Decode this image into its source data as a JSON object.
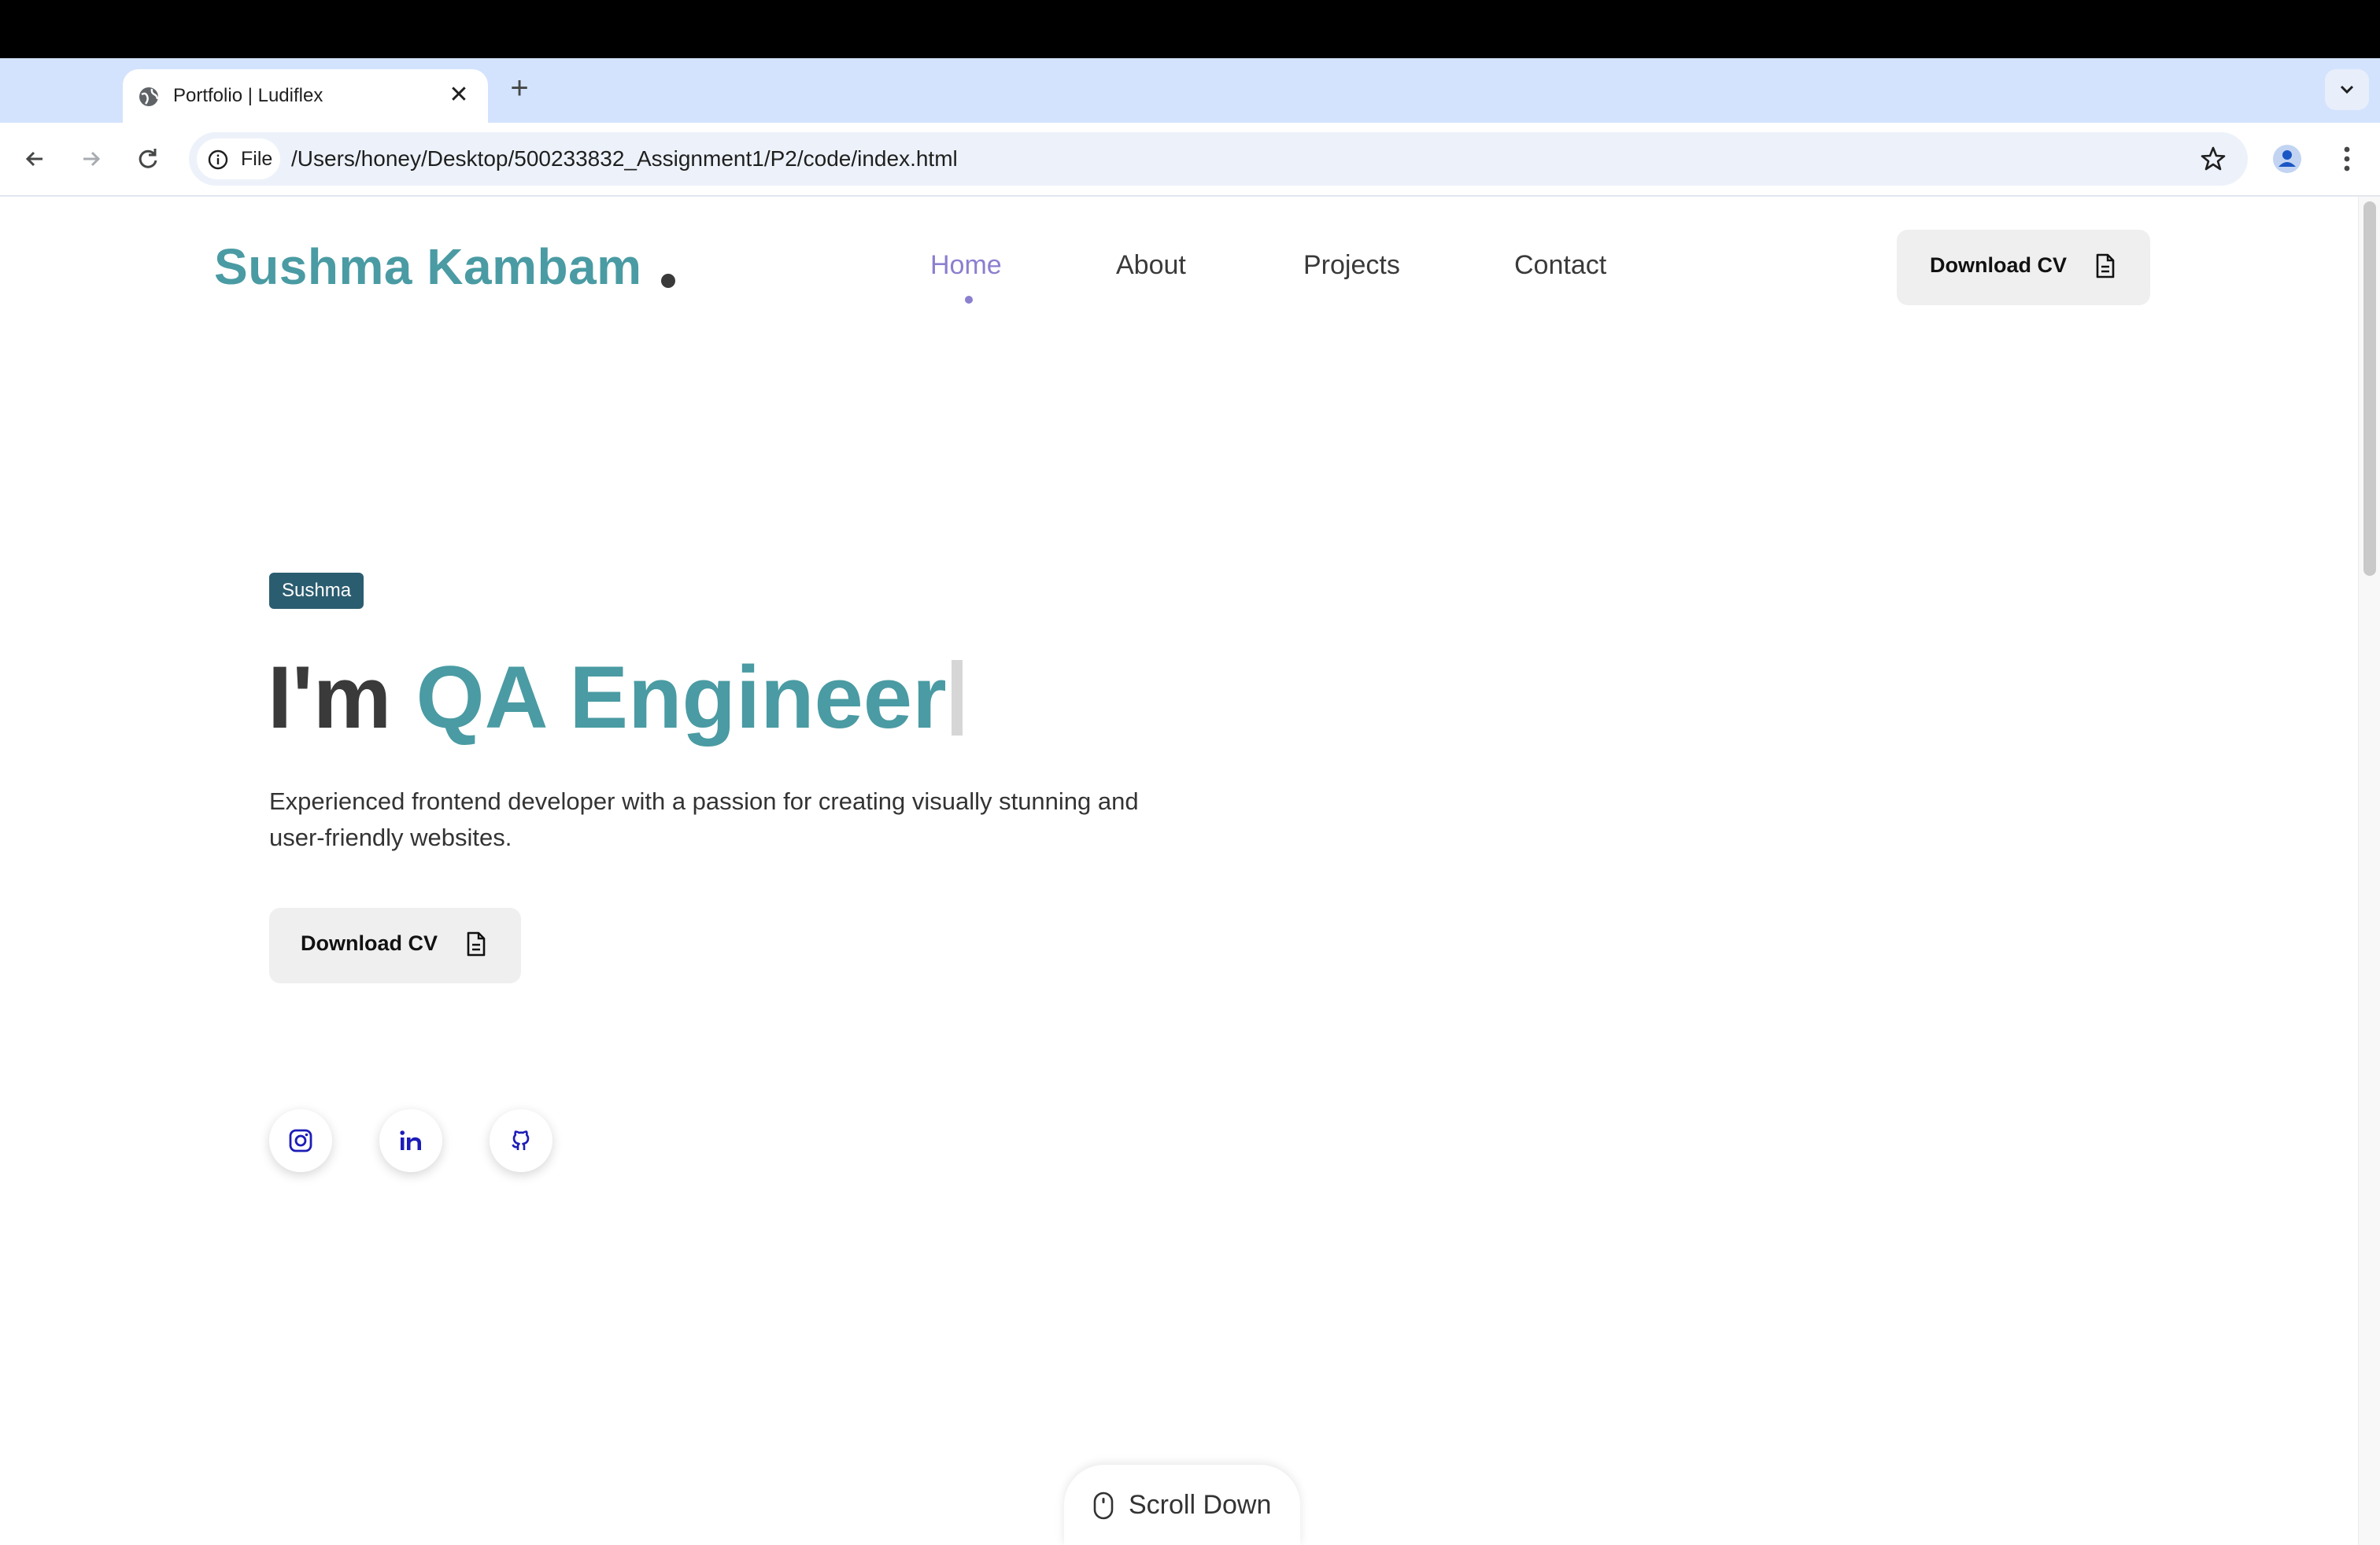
{
  "browser": {
    "tab": {
      "title": "Portfolio | Ludiflex"
    },
    "omnibox": {
      "chip_label": "File",
      "url": "/Users/honey/Desktop/500233832_Assignment1/P2/code/index.html"
    },
    "new_tab_symbol": "+",
    "close_symbol": "✕",
    "icons": [
      "globe-icon",
      "back-icon",
      "forward-icon",
      "reload-icon",
      "info-icon",
      "star-icon",
      "profile-icon",
      "kebab-menu-icon",
      "chevron-down-icon"
    ]
  },
  "page": {
    "logo": "Sushma Kambam",
    "nav": [
      {
        "label": "Home",
        "active": true
      },
      {
        "label": "About",
        "active": false
      },
      {
        "label": "Projects",
        "active": false
      },
      {
        "label": "Contact",
        "active": false
      }
    ],
    "header_cv_label": "Download CV",
    "hero": {
      "badge": "Sushma",
      "headline_prefix": "I'm",
      "headline_role": "QA Engineer",
      "description": "Experienced frontend developer with a passion for creating visually stunning and user-friendly websites.",
      "cv_label": "Download CV"
    },
    "social": [
      "instagram-icon",
      "linkedin-icon",
      "github-icon"
    ],
    "scroll_label": "Scroll Down",
    "colors": {
      "brand_teal": "#4a9ba3",
      "nav_active": "#8b7fcf",
      "badge_bg": "#2b5d70",
      "social_icon": "#1c1cb8"
    }
  }
}
